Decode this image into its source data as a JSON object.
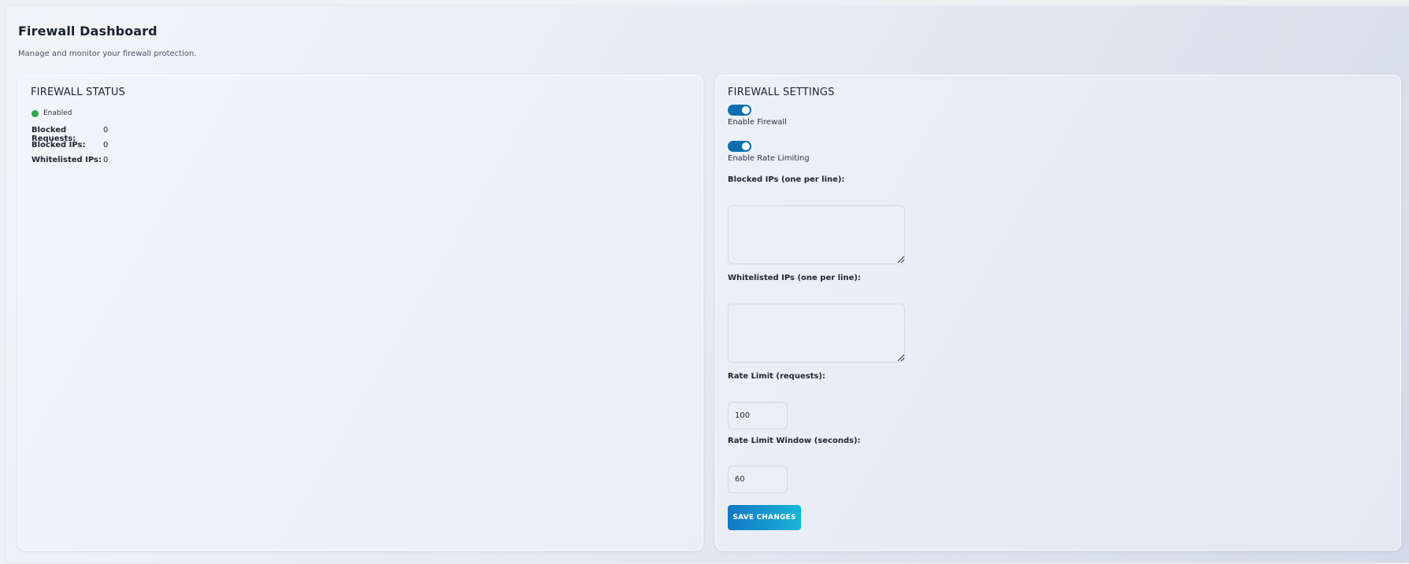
{
  "header": {
    "title": "Firewall Dashboard",
    "subtitle": "Manage and monitor your firewall protection."
  },
  "status_card": {
    "title": "FIREWALL STATUS",
    "status_text": "Enabled",
    "status_color": "#2fa84f",
    "stats": [
      {
        "label": "Blocked Requests:",
        "value": "0"
      },
      {
        "label": "Blocked IPs:",
        "value": "0"
      },
      {
        "label": "Whitelisted IPs:",
        "value": "0"
      }
    ]
  },
  "settings_card": {
    "title": "FIREWALL SETTINGS",
    "enable_firewall": {
      "label": "Enable Firewall",
      "checked": true
    },
    "enable_rate_limiting": {
      "label": "Enable Rate Limiting",
      "checked": true
    },
    "blocked_ips": {
      "label": "Blocked IPs (one per line):",
      "value": ""
    },
    "whitelisted_ips": {
      "label": "Whitelisted IPs (one per line):",
      "value": ""
    },
    "rate_limit": {
      "label": "Rate Limit (requests):",
      "value": "100"
    },
    "rate_limit_window": {
      "label": "Rate Limit Window (seconds):",
      "value": "60"
    },
    "save_label": "SAVE CHANGES"
  },
  "colors": {
    "accent": "#0f6fb0",
    "button_gradient_start": "#1277c4",
    "button_gradient_end": "#18b4d8"
  },
  "icons": {
    "status": "status-dot-icon",
    "resize": "resize-handle-icon"
  }
}
